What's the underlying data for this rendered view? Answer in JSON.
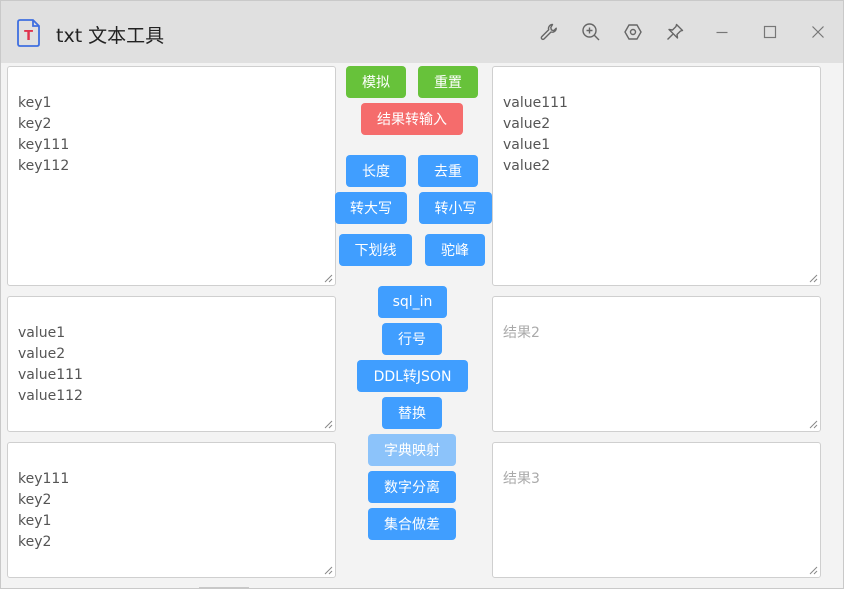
{
  "window": {
    "title": "txt 文本工具",
    "app_icon_letter": "T"
  },
  "titlebar": {
    "icons": [
      "wrench-icon",
      "zoom-in-icon",
      "hexagon-settings-icon",
      "pin-icon",
      "minimize-icon",
      "maximize-icon",
      "close-icon"
    ]
  },
  "inputs": {
    "input1": "key1\nkey2\nkey111\nkey112",
    "input2": "value1\nvalue2\nvalue111\nvalue112",
    "input3": "key111\nkey2\nkey1\nkey2"
  },
  "results": {
    "result1": "value111\nvalue2\nvalue1\nvalue2",
    "result2_placeholder": "结果2",
    "result3_placeholder": "结果3"
  },
  "buttons": {
    "mock": "模拟",
    "reset": "重置",
    "result_to_input": "结果转输入",
    "length": "长度",
    "dedupe": "去重",
    "to_upper": "转大写",
    "to_lower": "转小写",
    "underscore": "下划线",
    "camel": "驼峰",
    "sql_in": "sql_in",
    "line_number": "行号",
    "ddl_to_json": "DDL转JSON",
    "replace": "替换",
    "dict_map": "字典映射",
    "digit_split": "数字分离",
    "set_diff": "集合做差"
  },
  "colors": {
    "green": "#67c23a",
    "red": "#f56c6c",
    "blue": "#409eff",
    "disabled_blue": "#8cc3fa"
  }
}
